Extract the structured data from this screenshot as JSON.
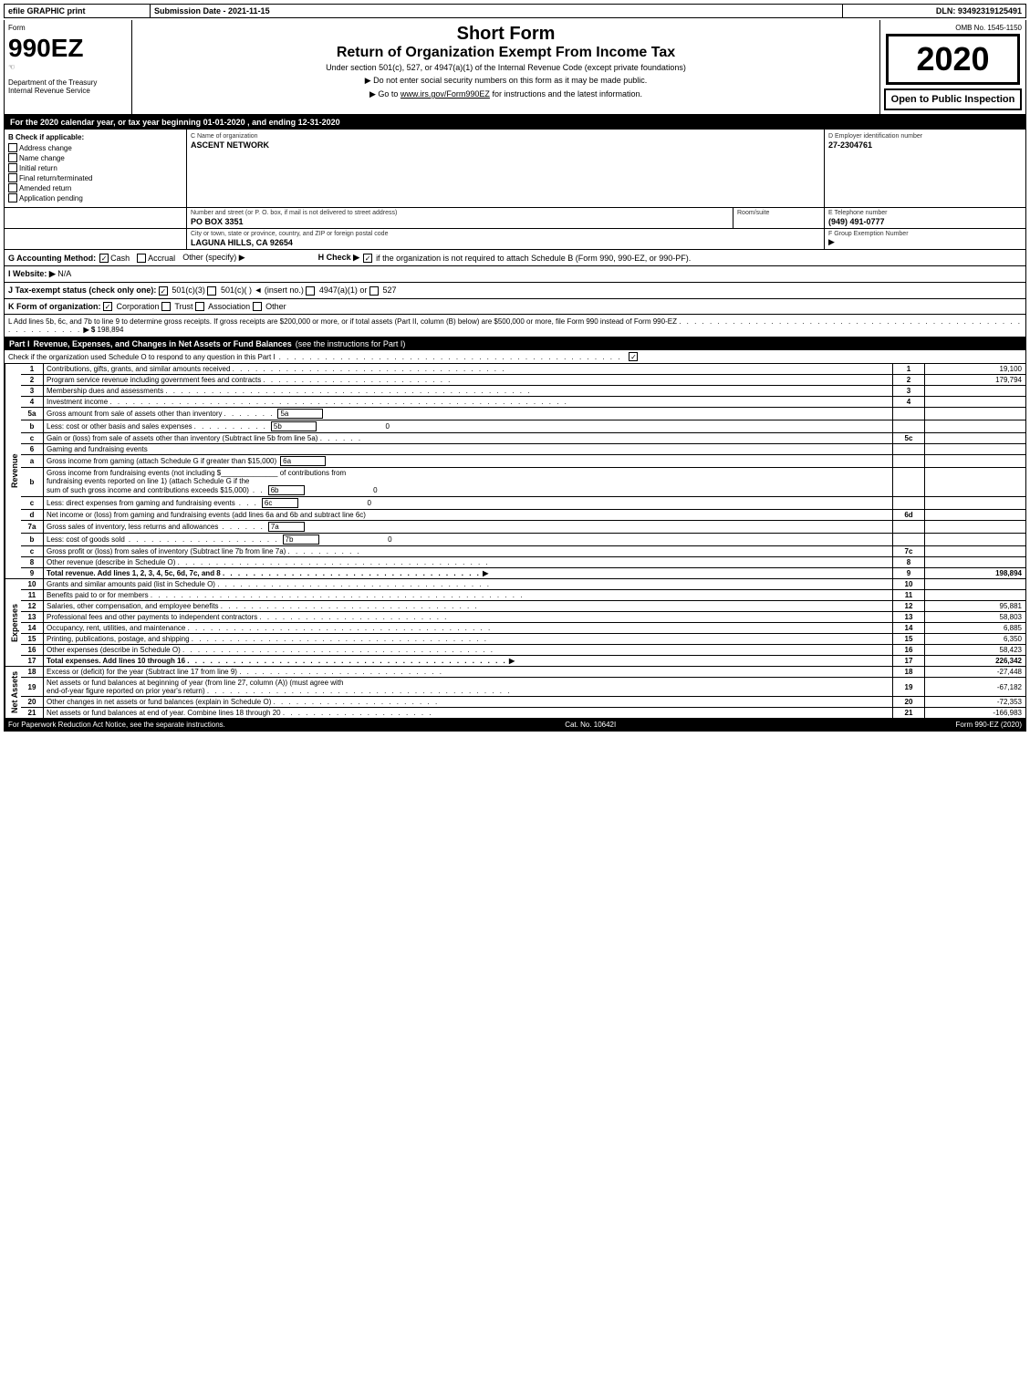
{
  "header": {
    "efile": "efile GRAPHIC print",
    "submission_label": "Submission Date -",
    "submission_date": "2021-11-15",
    "dln_label": "DLN:",
    "dln_number": "93492319125491"
  },
  "form": {
    "number": "990EZ",
    "symbol": "☜",
    "title_short": "Short Form",
    "title_return": "Return of Organization Exempt From Income Tax",
    "under_section": "Under section 501(c), 527, or 4947(a)(1) of the Internal Revenue Code (except private foundations)",
    "do_not_enter": "▶ Do not enter social security numbers on this form as it may be made public.",
    "go_to": "▶ Go to www.irs.gov/Form990EZ for instructions and the latest information.",
    "go_to_url": "www.irs.gov/Form990EZ",
    "year": "2020",
    "omb": "OMB No. 1545-1150",
    "open_to_public": "Open to Public Inspection",
    "dept": "Department of the Treasury",
    "irs_label": "Internal Revenue Service"
  },
  "for_year_line": "For the 2020 calendar year, or tax year beginning 01-01-2020 , and ending 12-31-2020",
  "check_if_applicable": {
    "label": "B Check if applicable:",
    "items": [
      {
        "label": "Address change",
        "checked": false
      },
      {
        "label": "Name change",
        "checked": false
      },
      {
        "label": "Initial return",
        "checked": false
      },
      {
        "label": "Final return/terminated",
        "checked": false
      },
      {
        "label": "Amended return",
        "checked": false
      },
      {
        "label": "Application pending",
        "checked": false
      }
    ]
  },
  "org": {
    "c_label": "C Name of organization",
    "name": "ASCENT NETWORK",
    "address_label": "Number and street (or P. O. box, if mail is not delivered to street address)",
    "address": "PO BOX 3351",
    "room_label": "Room/suite",
    "room": "",
    "city_label": "City or town, state or province, country, and ZIP or foreign postal code",
    "city": "LAGUNA HILLS, CA  92654"
  },
  "ein": {
    "d_label": "D Employer identification number",
    "ein": "27-2304761",
    "e_label": "E Telephone number",
    "phone": "(949) 491-0777",
    "f_label": "F Group Exemption Number",
    "f_arrow": "▶"
  },
  "accounting": {
    "g_label": "G Accounting Method:",
    "cash_label": "Cash",
    "cash_checked": true,
    "accrual_label": "Accrual",
    "accrual_checked": false,
    "other_label": "Other (specify) ▶",
    "h_label": "H Check ▶",
    "h_checked": true,
    "h_text": "if the organization is not required to attach Schedule B (Form 990, 990-EZ, or 990-PF)."
  },
  "website": {
    "i_label": "I Website: ▶",
    "url": "N/A"
  },
  "tax_status": {
    "j_label": "J Tax-exempt status (check only one):",
    "options": [
      "501(c)(3)",
      "501(c)(  ) ◄ (insert no.)",
      "4947(a)(1) or",
      "527"
    ],
    "checked": "501(c)(3)"
  },
  "form_org": {
    "k_label": "K Form of organization:",
    "corporation_label": "Corporation",
    "corporation_checked": true,
    "trust_label": "Trust",
    "trust_checked": false,
    "association_label": "Association",
    "association_checked": false,
    "other_label": "Other"
  },
  "l_line": {
    "text": "L Add lines 5b, 6c, and 7b to line 9 to determine gross receipts. If gross receipts are $200,000 or more, or if total assets (Part II, column (B) below) are $500,000 or more, file Form 990 instead of Form 990-EZ",
    "dots": ". . . . . . . . . . . . . . . . . . . . . . . . . . . . . . . . . . . . . . . . . . . . . . . . . . . . . . . . . . . . . .",
    "arrow": "▶ $",
    "value": "198,894"
  },
  "part1": {
    "label": "Part I",
    "title": "Revenue, Expenses, and Changes in Net Assets or Fund Balances",
    "see_instructions": "(see the instructions for Part I)",
    "schedule_o_check": "Check if the organization used Schedule O to respond to any question in this Part I",
    "check_symbol": "☑",
    "rows": [
      {
        "num": "1",
        "desc": "Contributions, gifts, grants, and similar amounts received",
        "dots": true,
        "line": "1",
        "amount": "19,100"
      },
      {
        "num": "2",
        "desc": "Program service revenue including government fees and contracts",
        "dots": true,
        "line": "2",
        "amount": "179,794"
      },
      {
        "num": "3",
        "desc": "Membership dues and assessments",
        "dots": true,
        "line": "3",
        "amount": ""
      },
      {
        "num": "4",
        "desc": "Investment income",
        "dots": true,
        "line": "4",
        "amount": ""
      },
      {
        "num": "5a",
        "desc": "Gross amount from sale of assets other than inventory",
        "ref": "5a",
        "dots": false,
        "line": "",
        "amount": ""
      },
      {
        "num": "b",
        "desc": "Less: cost or other basis and sales expenses",
        "ref": "5b",
        "dots": true,
        "line": "",
        "sub_amount": "0",
        "amount": ""
      },
      {
        "num": "c",
        "desc": "Gain or (loss) from sale of assets other than inventory (Subtract line 5b from line 5a)",
        "dots": true,
        "line": "5c",
        "amount": ""
      },
      {
        "num": "6",
        "desc": "Gaming and fundraising events",
        "dots": false,
        "line": "",
        "amount": ""
      },
      {
        "num": "a",
        "desc": "Gross income from gaming (attach Schedule G if greater than $15,000)",
        "ref": "6a",
        "dots": false,
        "line": "",
        "amount": ""
      },
      {
        "num": "b",
        "desc": "Gross income from fundraising events (not including $_______________  of contributions from fundraising events reported on line 1) (attach Schedule G if the sum of such gross income and contributions exceeds $15,000)",
        "ref": "6b",
        "dots": true,
        "line": "",
        "sub_amount": "0",
        "amount": ""
      },
      {
        "num": "c",
        "desc": "Less: direct expenses from gaming and fundraising events",
        "ref": "6c",
        "dots": true,
        "line": "",
        "sub_amount": "0",
        "amount": ""
      },
      {
        "num": "d",
        "desc": "Net income or (loss) from gaming and fundraising events (add lines 6a and 6b and subtract line 6c)",
        "dots": false,
        "line": "6d",
        "amount": ""
      },
      {
        "num": "7a",
        "desc": "Gross sales of inventory, less returns and allowances",
        "ref": "7a",
        "dots": true,
        "line": "",
        "amount": ""
      },
      {
        "num": "b",
        "desc": "Less: cost of goods sold",
        "ref": "7b",
        "dots": true,
        "line": "",
        "sub_amount": "0",
        "amount": ""
      },
      {
        "num": "c",
        "desc": "Gross profit or (loss) from sales of inventory (Subtract line 7b from line 7a)",
        "dots": true,
        "line": "7c",
        "amount": ""
      },
      {
        "num": "8",
        "desc": "Other revenue (describe in Schedule O)",
        "dots": true,
        "line": "8",
        "amount": ""
      },
      {
        "num": "9",
        "desc": "Total revenue. Add lines 1, 2, 3, 4, 5c, 6d, 7c, and 8",
        "dots": true,
        "arrow": "▶",
        "line": "9",
        "amount": "198,894",
        "bold": true
      }
    ]
  },
  "expenses": {
    "label": "Expenses",
    "rows": [
      {
        "num": "10",
        "desc": "Grants and similar amounts paid (list in Schedule O)",
        "dots": true,
        "line": "10",
        "amount": ""
      },
      {
        "num": "11",
        "desc": "Benefits paid to or for members",
        "dots": true,
        "line": "11",
        "amount": ""
      },
      {
        "num": "12",
        "desc": "Salaries, other compensation, and employee benefits",
        "dots": true,
        "line": "12",
        "amount": "95,881"
      },
      {
        "num": "13",
        "desc": "Professional fees and other payments to independent contractors",
        "dots": true,
        "line": "13",
        "amount": "58,803"
      },
      {
        "num": "14",
        "desc": "Occupancy, rent, utilities, and maintenance",
        "dots": true,
        "line": "14",
        "amount": "6,885"
      },
      {
        "num": "15",
        "desc": "Printing, publications, postage, and shipping",
        "dots": true,
        "line": "15",
        "amount": "6,350"
      },
      {
        "num": "16",
        "desc": "Other expenses (describe in Schedule O)",
        "dots": true,
        "line": "16",
        "amount": "58,423"
      },
      {
        "num": "17",
        "desc": "Total expenses. Add lines 10 through 16",
        "dots": true,
        "arrow": "▶",
        "line": "17",
        "amount": "226,342",
        "bold": true
      }
    ]
  },
  "net_assets": {
    "label": "Net Assets",
    "rows": [
      {
        "num": "18",
        "desc": "Excess or (deficit) for the year (Subtract line 17 from line 9)",
        "dots": true,
        "line": "18",
        "amount": "-27,448"
      },
      {
        "num": "19",
        "desc": "Net assets or fund balances at beginning of year (from line 27, column (A)) (must agree with end-of-year figure reported on prior year's return)",
        "dots": true,
        "line": "19",
        "amount": "-67,182"
      },
      {
        "num": "20",
        "desc": "Other changes in net assets or fund balances (explain in Schedule O)",
        "dots": true,
        "line": "20",
        "amount": "-72,353"
      },
      {
        "num": "21",
        "desc": "Net assets or fund balances at end of year. Combine lines 18 through 20",
        "dots": true,
        "line": "21",
        "amount": "-166,983"
      }
    ]
  },
  "footer": {
    "paperwork_text": "For Paperwork Reduction Act Notice, see the separate instructions.",
    "cat_no": "Cat. No. 10642I",
    "form_label": "Form 990-EZ (2020)"
  }
}
